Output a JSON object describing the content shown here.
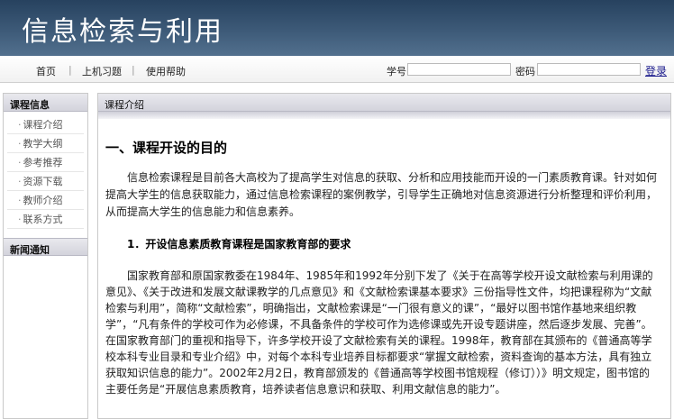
{
  "header": {
    "title": "信息检索与利用"
  },
  "nav": {
    "links": [
      "首页",
      "上机习题",
      "使用帮助"
    ],
    "separator": "|",
    "student_id_label": "学号",
    "password_label": "密码",
    "login_label": "登录"
  },
  "sidebar": {
    "course_title": "课程信息",
    "items": [
      {
        "label": "课程介绍"
      },
      {
        "label": "教学大纲"
      },
      {
        "label": "参考推荐"
      },
      {
        "label": "资源下载"
      },
      {
        "label": "教师介绍"
      },
      {
        "label": "联系方式"
      }
    ],
    "bullet": "·",
    "news_title": "新闻通知"
  },
  "main": {
    "section_title": "课程介绍",
    "heading1": "一、课程开设的目的",
    "para1": "信息检索课程是目前各大高校为了提高学生对信息的获取、分析和应用技能而开设的一门素质教育课。针对如何提高大学生的信息获取能力，通过信息检索课程的案例教学，引导学生正确地对信息资源进行分析整理和评价利用，从而提高大学生的信息能力和信息素养。",
    "heading2": "1．开设信息素质教育课程是国家教育部的要求",
    "para2": "国家教育部和原国家教委在1984年、1985年和1992年分别下发了《关于在高等学校开设文献检索与利用课的意见》、《关于改进和发展文献课教学的几点意见》和《文献检索课基本要求》三份指导性文件，均把课程称为“文献检索与利用”，简称“文献检索”，明确指出，文献检索课是“一门很有意义的课”，“最好以图书馆作基地来组织教学”，“凡有条件的学校可作为必修课，不具备条件的学校可作为选修课或先开设专题讲座，然后逐步发展、完善”。在国家教育部门的重视和指导下，许多学校开设了文献检索有关的课程。1998年，教育部在其颁布的《普通高等学校本科专业目录和专业介绍》中，对每个本科专业培养目标都要求“掌握文献检索，资料查询的基本方法，具有独立获取知识信息的能力”。2002年2月2日，教育部颁发的《普通高等学校图书馆规程（修订））》明文规定，图书馆的主要任务是“开展信息素质教育，培养读者信息意识和获取、利用文献信息的能力”。"
  }
}
